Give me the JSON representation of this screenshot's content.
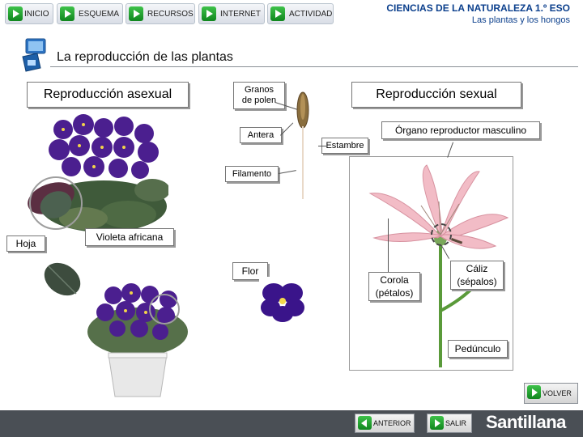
{
  "nav": {
    "items": [
      {
        "label": "INICIO"
      },
      {
        "label": "ESQUEMA"
      },
      {
        "label": "RECURSOS"
      },
      {
        "label": "INTERNET"
      },
      {
        "label": "ACTIVIDAD"
      }
    ]
  },
  "header": {
    "title": "CIENCIAS DE LA NATURALEZA 1.º ESO",
    "subtitle": "Las plantas y los hongos"
  },
  "section": {
    "title": "La reproducción de las plantas"
  },
  "labels": {
    "asexual": "Reproducción asexual",
    "sexual": "Reproducción sexual",
    "granos_line1": "Granos",
    "granos_line2": "de polen",
    "antera": "Antera",
    "estambre": "Estambre",
    "organo": "Órgano reproductor masculino",
    "filamento": "Filamento",
    "hoja": "Hoja",
    "violeta": "Violeta africana",
    "flor": "Flor",
    "corola_line1": "Corola",
    "corola_line2": "(pétalos)",
    "caliz_line1": "Cáliz",
    "caliz_line2": "(sépalos)",
    "pedunculo": "Pedúnculo"
  },
  "footer": {
    "volver": "VOLVER",
    "anterior": "ANTERIOR",
    "salir": "SALIR",
    "brand": "Santillana"
  },
  "colors": {
    "accent_green": "#1a9a2a",
    "header_blue": "#0b3f8c",
    "brand_bar": "#4a4f55",
    "violet": "#4b1f8f"
  }
}
